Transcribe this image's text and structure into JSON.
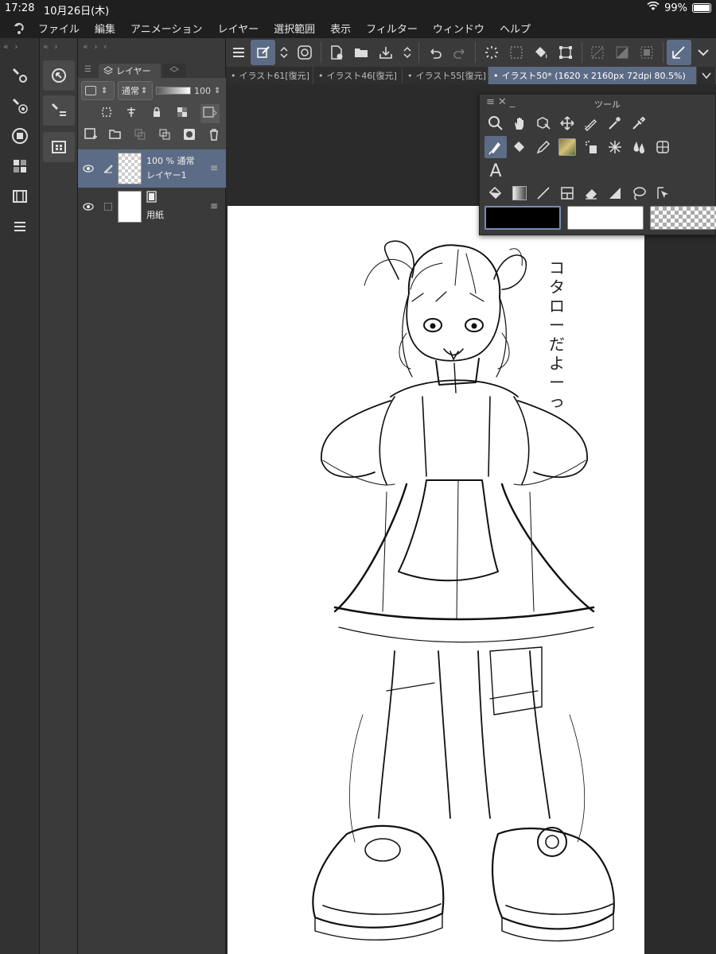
{
  "status": {
    "time": "17:28",
    "date": "10月26日(木)",
    "battery": "99%",
    "battery_level": 0.99
  },
  "menu": {
    "items": [
      "ファイル",
      "編集",
      "アニメーション",
      "レイヤー",
      "選択範囲",
      "表示",
      "フィルター",
      "ウィンドウ",
      "ヘルプ"
    ]
  },
  "layer_panel": {
    "tab_label": "レイヤー",
    "blend_mode": "通常",
    "opacity": "100",
    "layers": [
      {
        "name": "レイヤー1",
        "info": "100 % 通常",
        "selected": true
      },
      {
        "name": "用紙",
        "info": "",
        "selected": false
      }
    ]
  },
  "doc_tabs": [
    {
      "label": "イラスト61[復元]",
      "active": false
    },
    {
      "label": "イラスト46[復元]",
      "active": false
    },
    {
      "label": "イラスト55[復元]",
      "active": false
    },
    {
      "label": "イラスト50* (1620 x 2160px 72dpi 80.5%)",
      "active": true
    }
  ],
  "tool_palette": {
    "title": "ツール",
    "text_tool_glyph": "A",
    "main_color": "#000000",
    "sub_color": "#ffffff"
  },
  "canvas": {
    "annotation": "コタローだよーっ"
  },
  "colors": {
    "accent": "#5d6c86",
    "panel": "#3a3a3a",
    "bar": "#1f1f1f"
  }
}
